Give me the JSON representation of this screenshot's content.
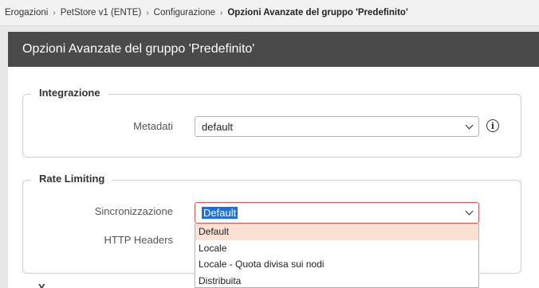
{
  "breadcrumb": {
    "items": [
      "Erogazioni",
      "PetStore v1 (ENTE)",
      "Configurazione"
    ],
    "current": "Opzioni Avanzate del gruppo 'Predefinito'",
    "separator": "›"
  },
  "header": {
    "title": "Opzioni Avanzate del gruppo 'Predefinito'"
  },
  "integrazione": {
    "legend": "Integrazione",
    "metadati_label": "Metadati",
    "metadati_value": "default",
    "info_icon": "i"
  },
  "rate_limiting": {
    "legend": "Rate Limiting",
    "sincronizzazione_label": "Sincronizzazione",
    "sincronizzazione_value": "Default",
    "http_headers_label": "HTTP Headers",
    "options": [
      "Default",
      "Locale",
      "Locale - Quota divisa sui nodi",
      "Distribuita"
    ],
    "highlighted_option": "Default"
  },
  "next_section": {
    "legend_partial": "Y..."
  },
  "colors": {
    "header_bg": "#4a4a4a",
    "focus_border": "#d9534f",
    "selection": "#1f6fd1",
    "option_highlight": "#fbe1d4"
  }
}
